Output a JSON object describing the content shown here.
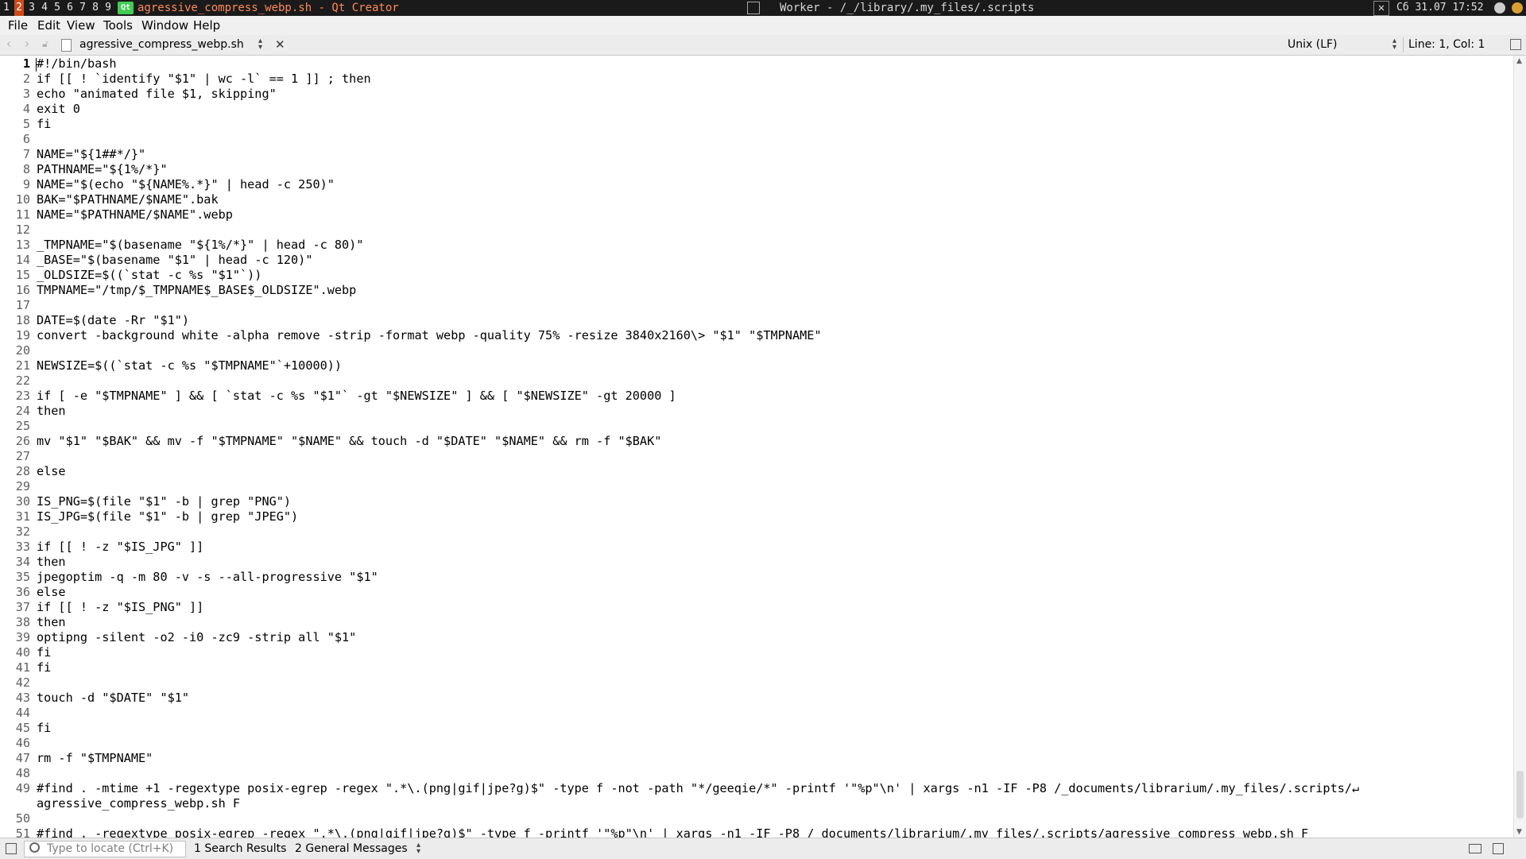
{
  "system_bar": {
    "workspaces": [
      "1",
      "2",
      "3",
      "4",
      "5",
      "6",
      "7",
      "8",
      "9"
    ],
    "active_workspace": "2",
    "app_logo_text": "Qt",
    "focused_window_title": "agressive_compress_webp.sh - Qt Creator",
    "other_window_title": "Worker - /_/library/.my_files/.scripts",
    "clock": "Сб 31.07 17:52"
  },
  "menu": {
    "items": [
      "File",
      "Edit",
      "View",
      "Tools",
      "Window",
      "Help"
    ]
  },
  "editor_toolbar": {
    "file_name": "agressive_compress_webp.sh",
    "line_ending": "Unix (LF)",
    "cursor_position": "Line: 1, Col: 1"
  },
  "code": {
    "line_numbers": [
      "1",
      "2",
      "3",
      "4",
      "5",
      "6",
      "7",
      "8",
      "9",
      "10",
      "11",
      "12",
      "13",
      "14",
      "15",
      "16",
      "17",
      "18",
      "19",
      "20",
      "21",
      "22",
      "23",
      "24",
      "25",
      "26",
      "27",
      "28",
      "29",
      "30",
      "31",
      "32",
      "33",
      "34",
      "35",
      "36",
      "37",
      "38",
      "39",
      "40",
      "41",
      "42",
      "43",
      "44",
      "45",
      "46",
      "47",
      "48",
      "49",
      "",
      "50",
      "51"
    ],
    "lines": [
      "#!/bin/bash",
      "if [[ ! `identify \"$1\" | wc -l` == 1 ]] ; then",
      "echo \"animated file $1, skipping\"",
      "exit 0",
      "fi",
      "",
      "NAME=\"${1##*/}\"",
      "PATHNAME=\"${1%/*}\"",
      "NAME=\"$(echo \"${NAME%.*}\" | head -c 250)\"",
      "BAK=\"$PATHNAME/$NAME\".bak",
      "NAME=\"$PATHNAME/$NAME\".webp",
      "",
      "_TMPNAME=\"$(basename \"${1%/*}\" | head -c 80)\"",
      "_BASE=\"$(basename \"$1\" | head -c 120)\"",
      "_OLDSIZE=$((`stat -c %s \"$1\"`))",
      "TMPNAME=\"/tmp/$_TMPNAME$_BASE$_OLDSIZE\".webp",
      "",
      "DATE=$(date -Rr \"$1\")",
      "convert -background white -alpha remove -strip -format webp -quality 75% -resize 3840x2160\\> \"$1\" \"$TMPNAME\"",
      "",
      "NEWSIZE=$((`stat -c %s \"$TMPNAME\"`+10000))",
      "",
      "if [ -e \"$TMPNAME\" ] && [ `stat -c %s \"$1\"` -gt \"$NEWSIZE\" ] && [ \"$NEWSIZE\" -gt 20000 ]",
      "then",
      "",
      "mv \"$1\" \"$BAK\" && mv -f \"$TMPNAME\" \"$NAME\" && touch -d \"$DATE\" \"$NAME\" && rm -f \"$BAK\"",
      "",
      "else",
      "",
      "IS_PNG=$(file \"$1\" -b | grep \"PNG\")",
      "IS_JPG=$(file \"$1\" -b | grep \"JPEG\")",
      "",
      "if [[ ! -z \"$IS_JPG\" ]]",
      "then",
      "jpegoptim -q -m 80 -v -s --all-progressive \"$1\"",
      "else",
      "if [[ ! -z \"$IS_PNG\" ]]",
      "then",
      "optipng -silent -o2 -i0 -zc9 -strip all \"$1\"",
      "fi",
      "fi",
      "",
      "touch -d \"$DATE\" \"$1\"",
      "",
      "fi",
      "",
      "rm -f \"$TMPNAME\"",
      "",
      "#find . -mtime +1 -regextype posix-egrep -regex \".*\\.(png|gif|jpe?g)$\" -type f -not -path \"*/geeqie/*\" -printf '\"%p\"\\n' | xargs -n1 -IF -P8 /_documents/librarium/.my_files/.scripts/↵",
      "agressive_compress_webp.sh F",
      "",
      "#find . -regextype posix-egrep -regex \".*\\.(png|gif|jpe?g)$\" -type f -printf '\"%p\"\\n' | xargs -n1 -IF -P8 /_documents/librarium/.my_files/.scripts/agressive_compress_webp.sh F"
    ]
  },
  "status_bar": {
    "locator_placeholder": "Type to locate (Ctrl+K)",
    "pane_1": "1  Search Results",
    "pane_2": "2  General Messages"
  }
}
